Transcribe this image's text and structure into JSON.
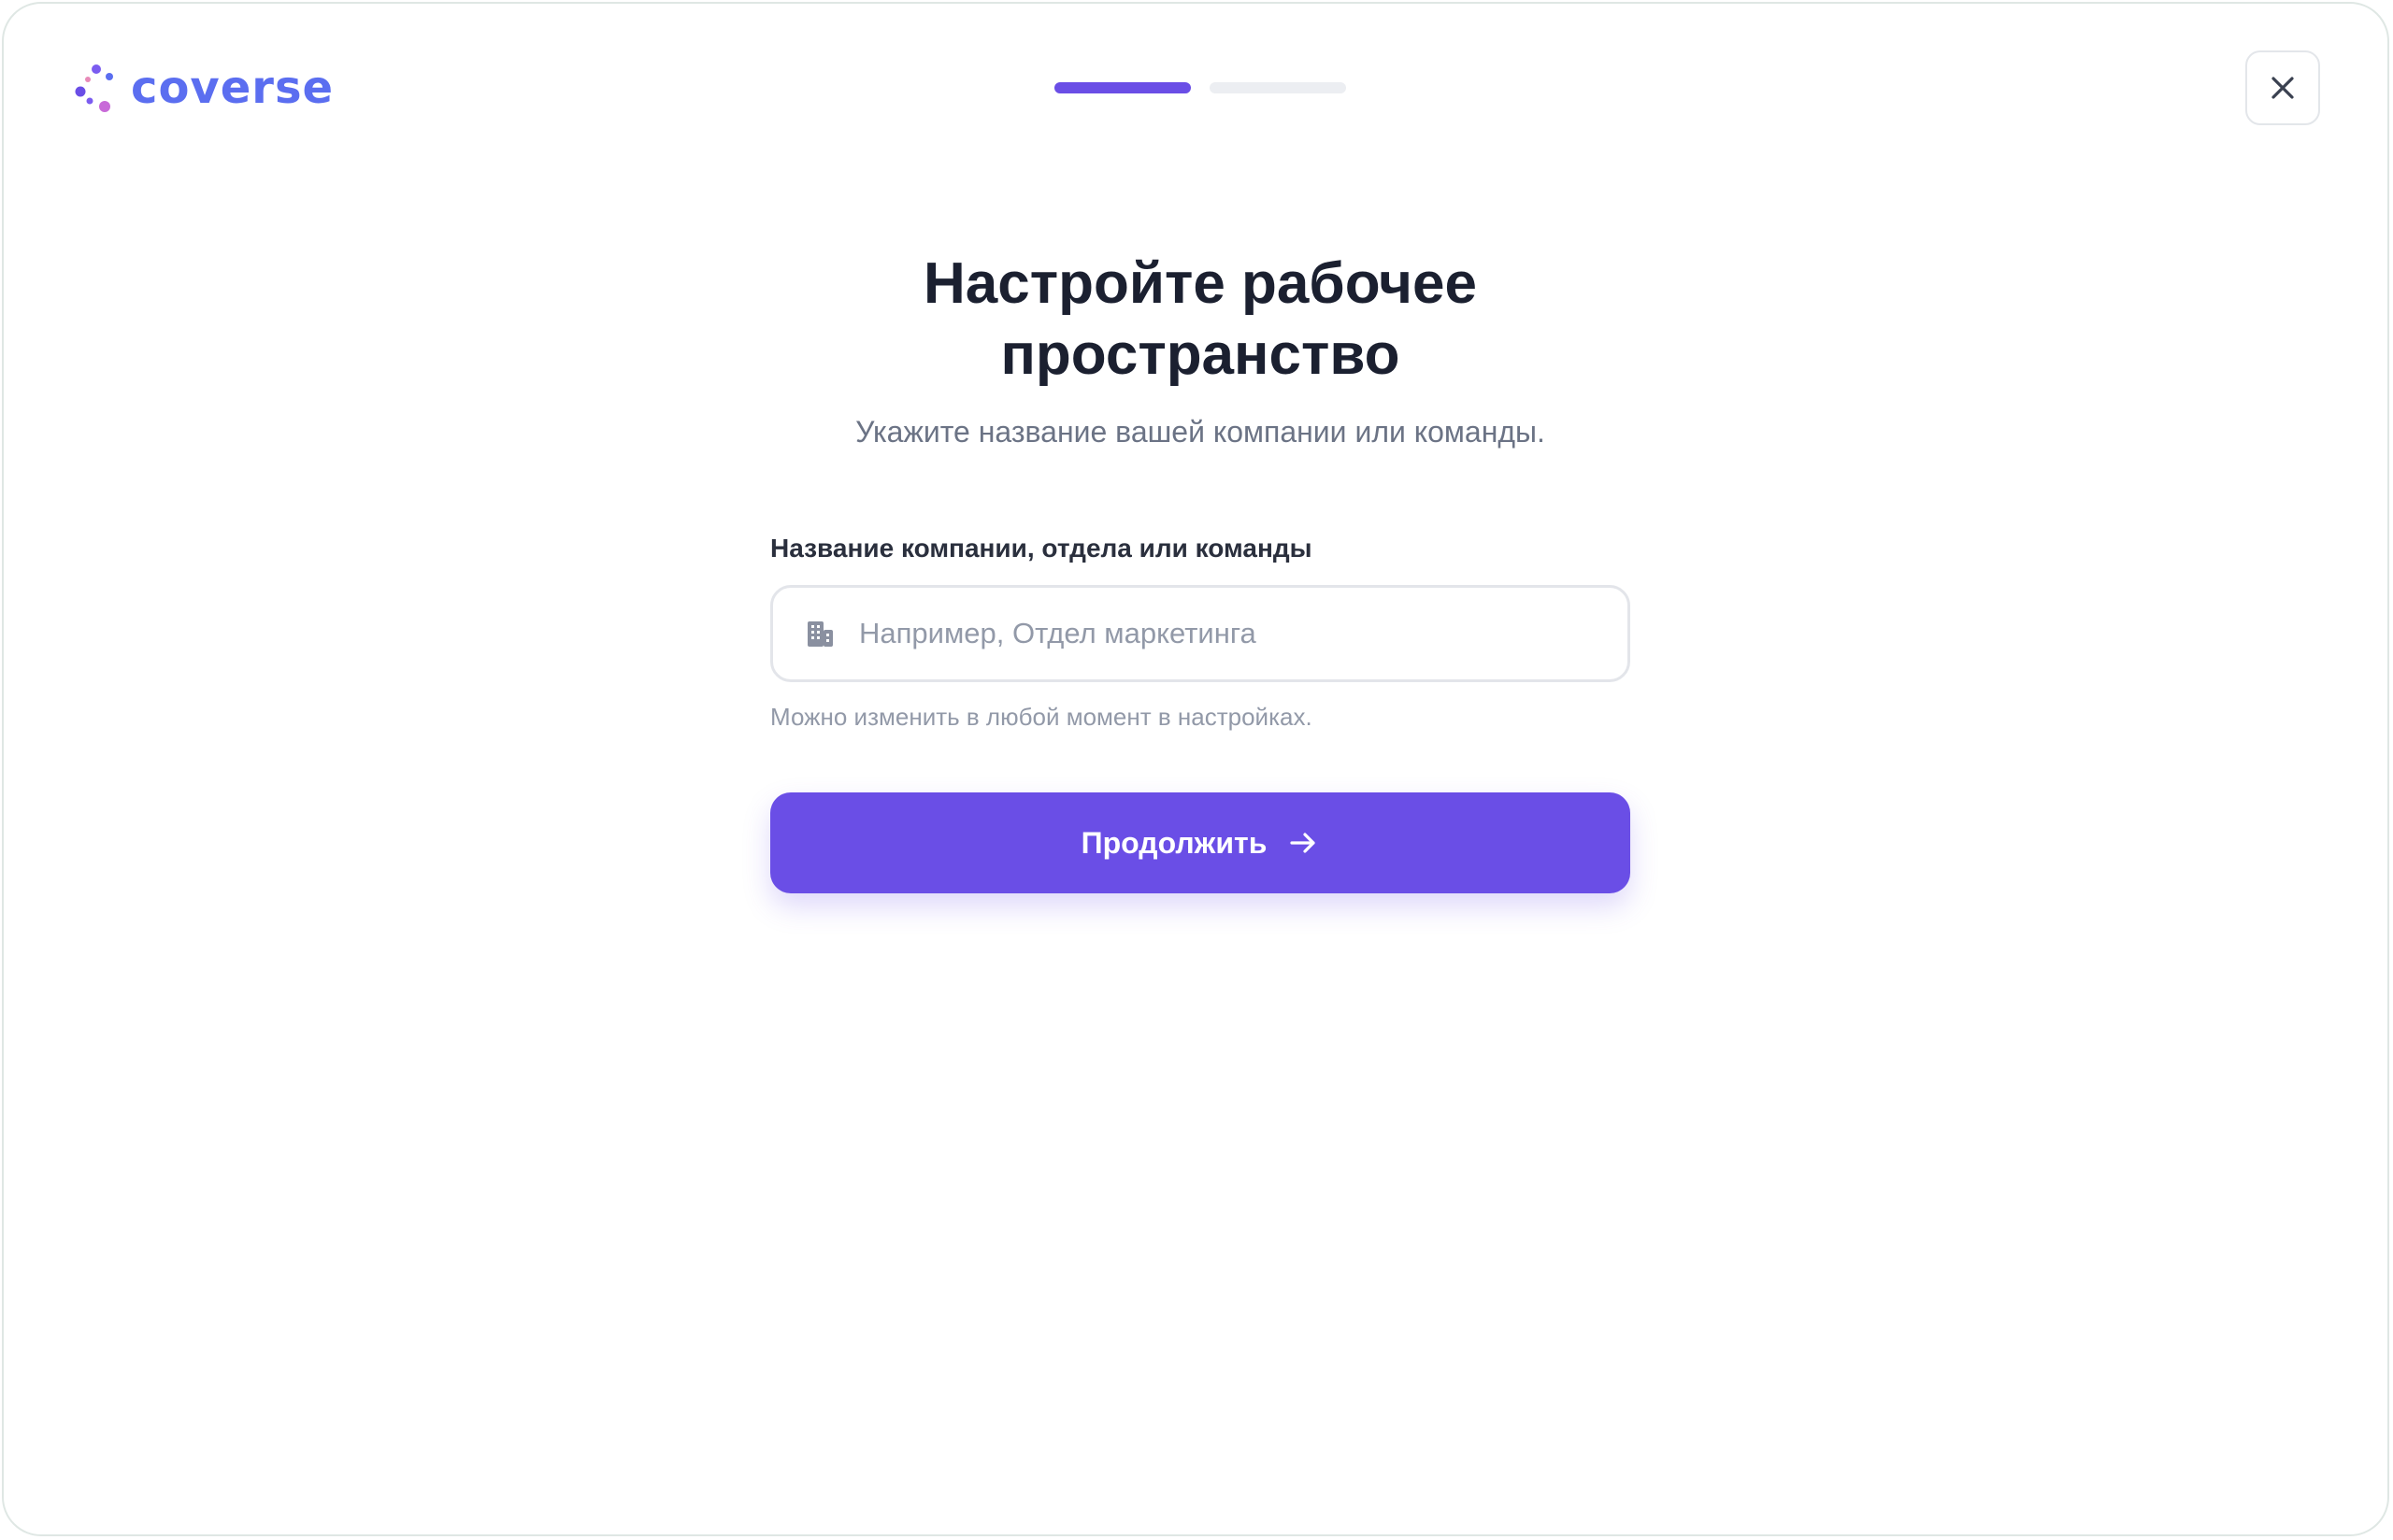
{
  "brand": {
    "name": "coverse",
    "color": "#5b6ef0"
  },
  "progress": {
    "current_step": 1,
    "total_steps": 2,
    "active_color": "#6a4ee6",
    "inactive_color": "#eceef2"
  },
  "header": {
    "close_icon": "close-icon"
  },
  "main": {
    "title": "Настройте рабочее пространство",
    "subtitle": "Укажите название вашей компании или команды."
  },
  "form": {
    "field_label": "Название компании, отдела или команды",
    "field_icon": "building-icon",
    "field_value": "",
    "field_placeholder": "Например, Отдел маркетинга",
    "hint": "Можно изменить в любой момент в настройках.",
    "submit_label": "Продолжить",
    "submit_icon": "arrow-right-icon",
    "submit_color": "#6a4ee6"
  }
}
